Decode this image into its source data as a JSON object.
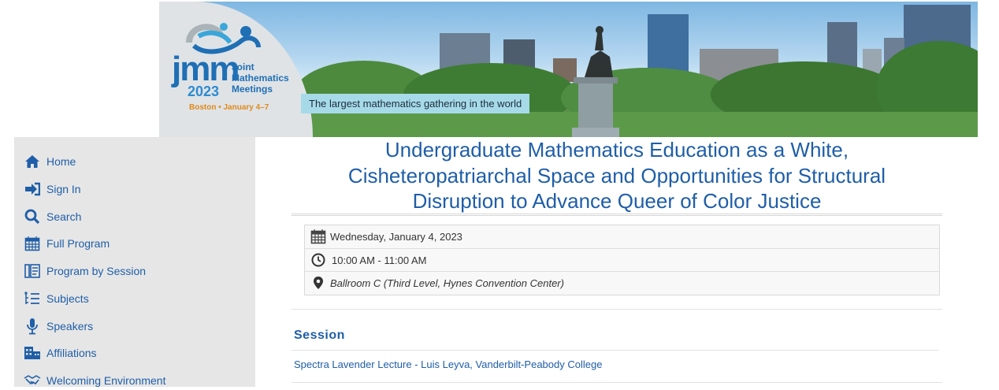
{
  "banner": {
    "logo_mark": "jmm",
    "logo_line1": "Joint",
    "logo_line2": "Mathematics",
    "logo_line3": "Meetings",
    "logo_year": "2023",
    "logo_city": "Boston • January 4–7",
    "tagline": "The largest mathematics gathering in the world"
  },
  "sidebar": {
    "items": [
      {
        "label": "Home",
        "icon": "home-icon"
      },
      {
        "label": "Sign In",
        "icon": "sign-in-icon"
      },
      {
        "label": "Search",
        "icon": "search-icon"
      },
      {
        "label": "Full Program",
        "icon": "calendar-icon"
      },
      {
        "label": "Program by Session",
        "icon": "program-icon"
      },
      {
        "label": "Subjects",
        "icon": "list-icon"
      },
      {
        "label": "Speakers",
        "icon": "microphone-icon"
      },
      {
        "label": "Affiliations",
        "icon": "building-icon"
      },
      {
        "label": "Welcoming Environment",
        "icon": "handshake-icon"
      }
    ]
  },
  "main": {
    "title_line1": "Undergraduate Mathematics Education as a White,",
    "title_line2": "Cisheteropatriarchal Space and Opportunities for Structural",
    "title_line3": "Disruption to Advance Queer of Color Justice",
    "date": "Wednesday, January 4, 2023",
    "time": "10:00 AM - 11:00 AM",
    "location": "Ballroom C (Third Level, Hynes Convention Center)",
    "session_heading": "Session",
    "session_link": "Spectra Lavender Lecture - Luis Leyva, Vanderbilt-Peabody College"
  },
  "colors": {
    "link_blue": "#1f5ea8",
    "sidebar_bg": "#e6e6e6",
    "tagline_bg": "#a7dae8"
  }
}
